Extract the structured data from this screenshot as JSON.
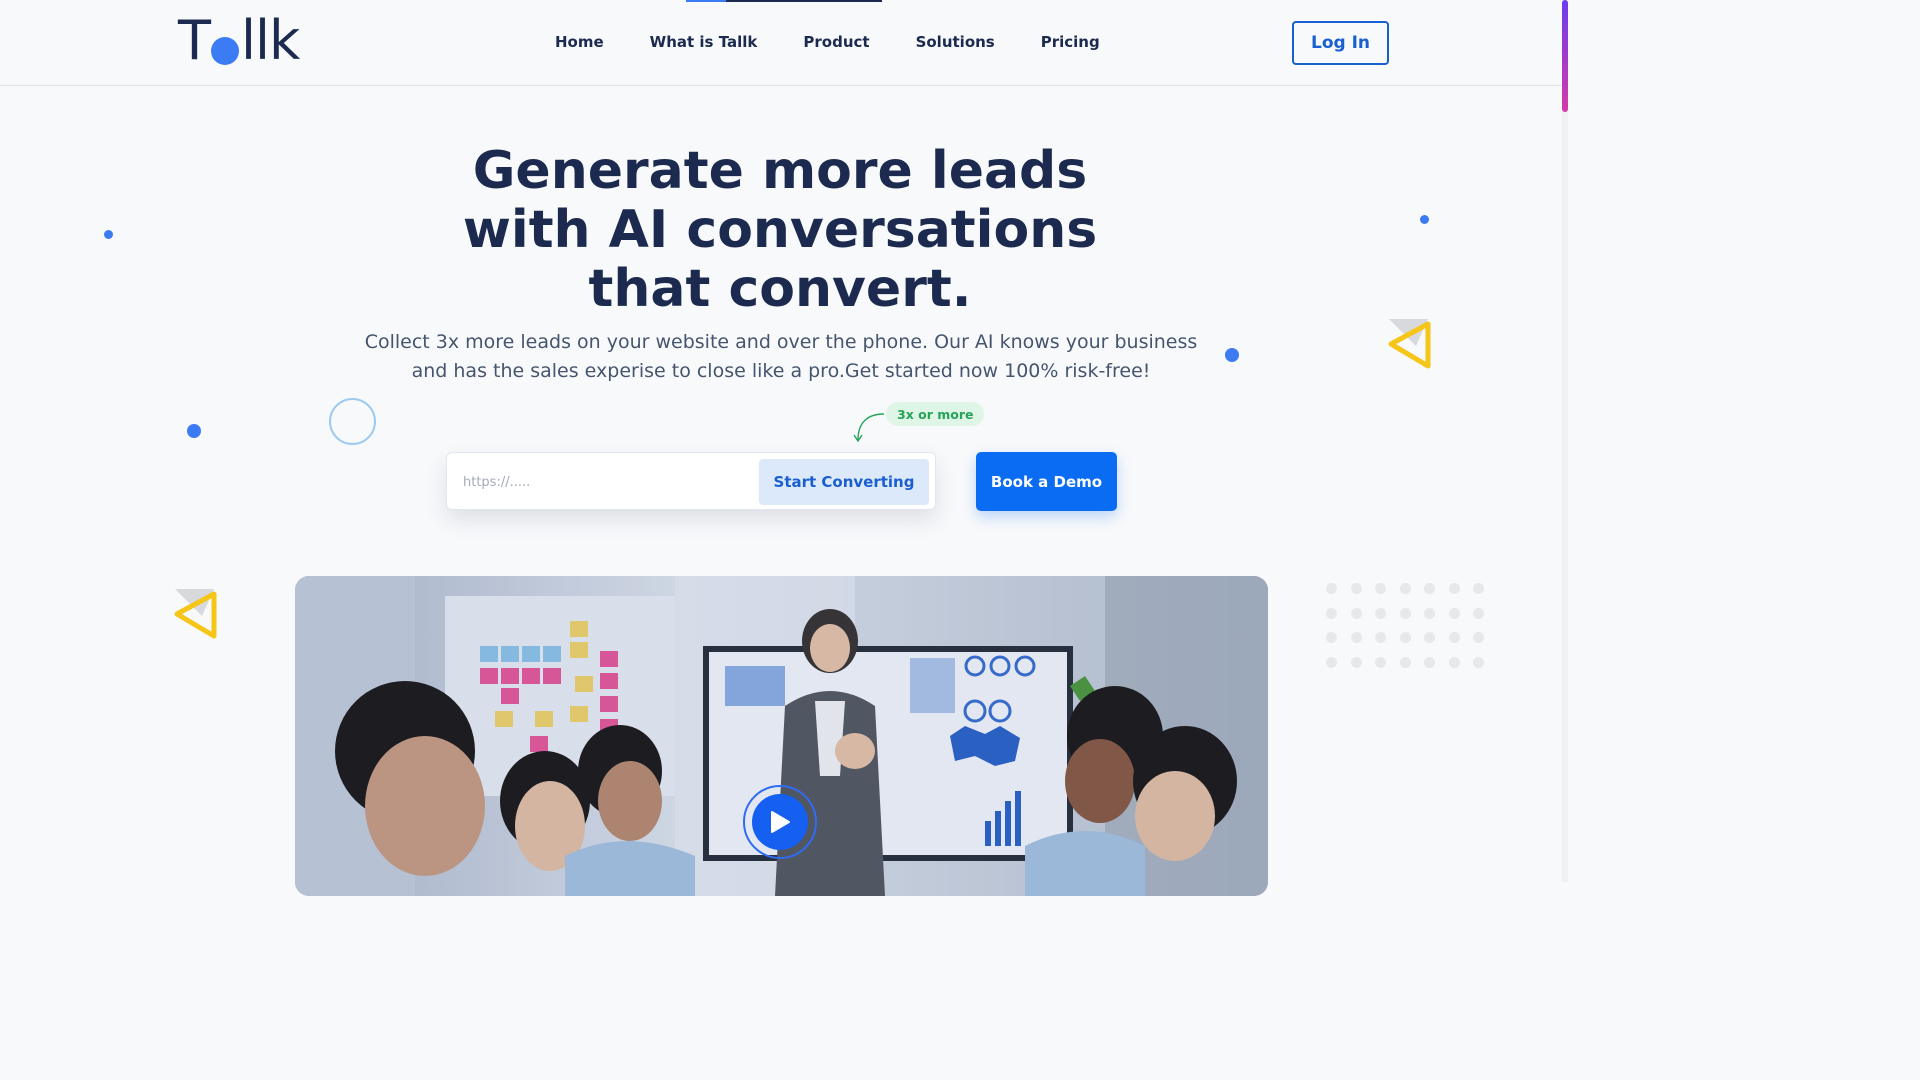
{
  "header": {
    "logo_prefix": "T",
    "logo_suffix": "llk",
    "nav": [
      "Home",
      "What is Tallk",
      "Product",
      "Solutions",
      "Pricing"
    ],
    "login_label": "Log In"
  },
  "hero": {
    "headline_lines": [
      "Generate more leads",
      "with AI conversations",
      "that convert."
    ],
    "subtext_lines": [
      "Collect 3x more leads on your website and over the phone. Our AI knows your business",
      "and has the sales experise to close like a pro.Get started now 100% risk-free!"
    ],
    "badge": "3x or more",
    "url_placeholder": "https://.....",
    "start_label": "Start Converting",
    "demo_label": "Book a Demo"
  },
  "colors": {
    "primary": "#0a6cf2",
    "navy": "#1b2a4e",
    "accent_blue": "#3b7cf5",
    "badge_green": "#27a35a",
    "triangle_yellow": "#f5c518"
  },
  "icons": {
    "play": "play-icon",
    "arrow": "curved-arrow-icon",
    "triangle": "triangle-decoration-icon"
  }
}
